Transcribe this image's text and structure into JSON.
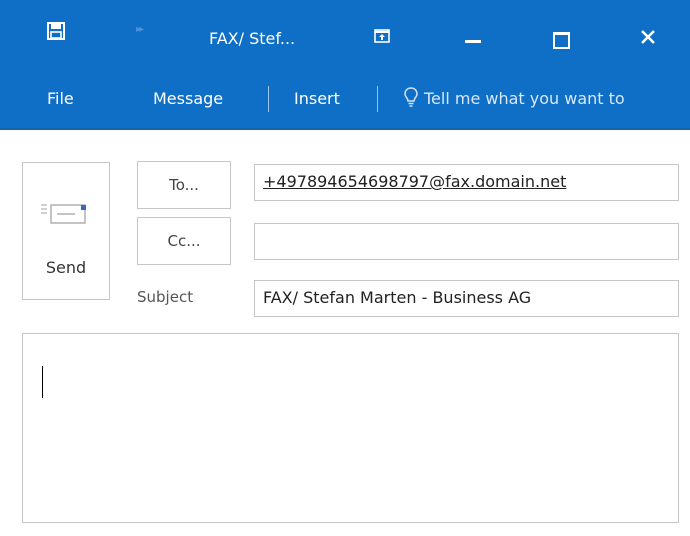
{
  "window": {
    "title": "FAX/ Stef...",
    "icons": {
      "save": "save-icon",
      "more": "more-commands-icon",
      "popout": "popout-icon",
      "minimize": "minimize-icon",
      "maximize": "maximize-icon",
      "close": "close-icon"
    },
    "accent_color": "#0f6fc6"
  },
  "ribbon": {
    "tabs": [
      "File",
      "Message",
      "Insert"
    ],
    "tell_me": "Tell me what you want to"
  },
  "compose": {
    "send_label": "Send",
    "to_label": "To...",
    "cc_label": "Cc...",
    "subject_label": "Subject",
    "to_value": "+497894654698797@fax.domain.net",
    "cc_value": "",
    "subject_value": "FAX/ Stefan Marten - Business AG",
    "body_text": ""
  }
}
